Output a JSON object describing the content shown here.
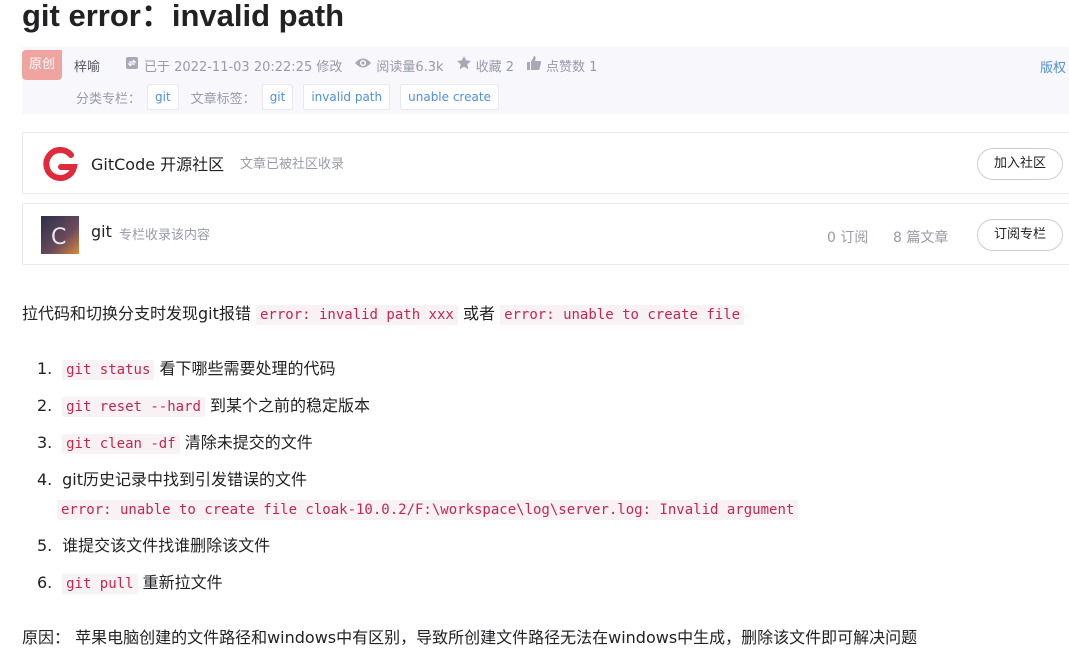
{
  "article": {
    "title": "git error：invalid path"
  },
  "meta": {
    "badge": "原创",
    "author": "梓喻",
    "updated": "已于 2022-11-03 20:22:25 修改",
    "views": "阅读量6.3k",
    "favorites": "收藏 2",
    "likes": "点赞数 1",
    "copyright": "版权",
    "column_label": "分类专栏：",
    "column_tag": "git",
    "tags_label": "文章标签：",
    "tags": [
      "git",
      "invalid path",
      "unable create"
    ]
  },
  "community_card": {
    "name": "GitCode 开源社区",
    "subtitle": "文章已被社区收录",
    "button": "加入社区"
  },
  "column_card": {
    "name": "git",
    "subtitle": "专栏收录该内容",
    "subscribers": "0 订阅",
    "articles": "8 篇文章",
    "button": "订阅专栏"
  },
  "body": {
    "intro_text": "拉代码和切换分支时发现git报错",
    "intro_code1": "error: invalid path xxx",
    "intro_or": "或者",
    "intro_code2": "error: unable to create file",
    "steps": [
      {
        "num": "1.",
        "code": "git status",
        "text": "看下哪些需要处理的代码"
      },
      {
        "num": "2.",
        "code": "git reset --hard",
        "text": "到某个之前的稳定版本"
      },
      {
        "num": "3.",
        "code": "git clean -df",
        "text": "清除未提交的文件"
      },
      {
        "num": "4.",
        "text": "git历史记录中找到引发错误的文件",
        "code": "error: unable to create file cloak-10.0.2/F:\\workspace\\log\\server.log: Invalid argument"
      },
      {
        "num": "5.",
        "text": "谁提交该文件找谁删除该文件"
      },
      {
        "num": "6.",
        "code": "git pull",
        "text": "重新拉文件"
      }
    ],
    "reason": "原因： 苹果电脑创建的文件路径和windows中有区别，导致所创建文件路径无法在windows中生成，删除该文件即可解决问题"
  },
  "colors": {
    "badge_bg": "#f0a4a0",
    "link": "#4e8fde",
    "code_text": "#c7254e",
    "code_bg": "#f9f2f4",
    "gitcode_red": "#e0293b"
  },
  "icons": [
    "update-icon",
    "eye-icon",
    "star-icon",
    "thumb-up-icon",
    "gitcode-logo",
    "column-cover"
  ]
}
